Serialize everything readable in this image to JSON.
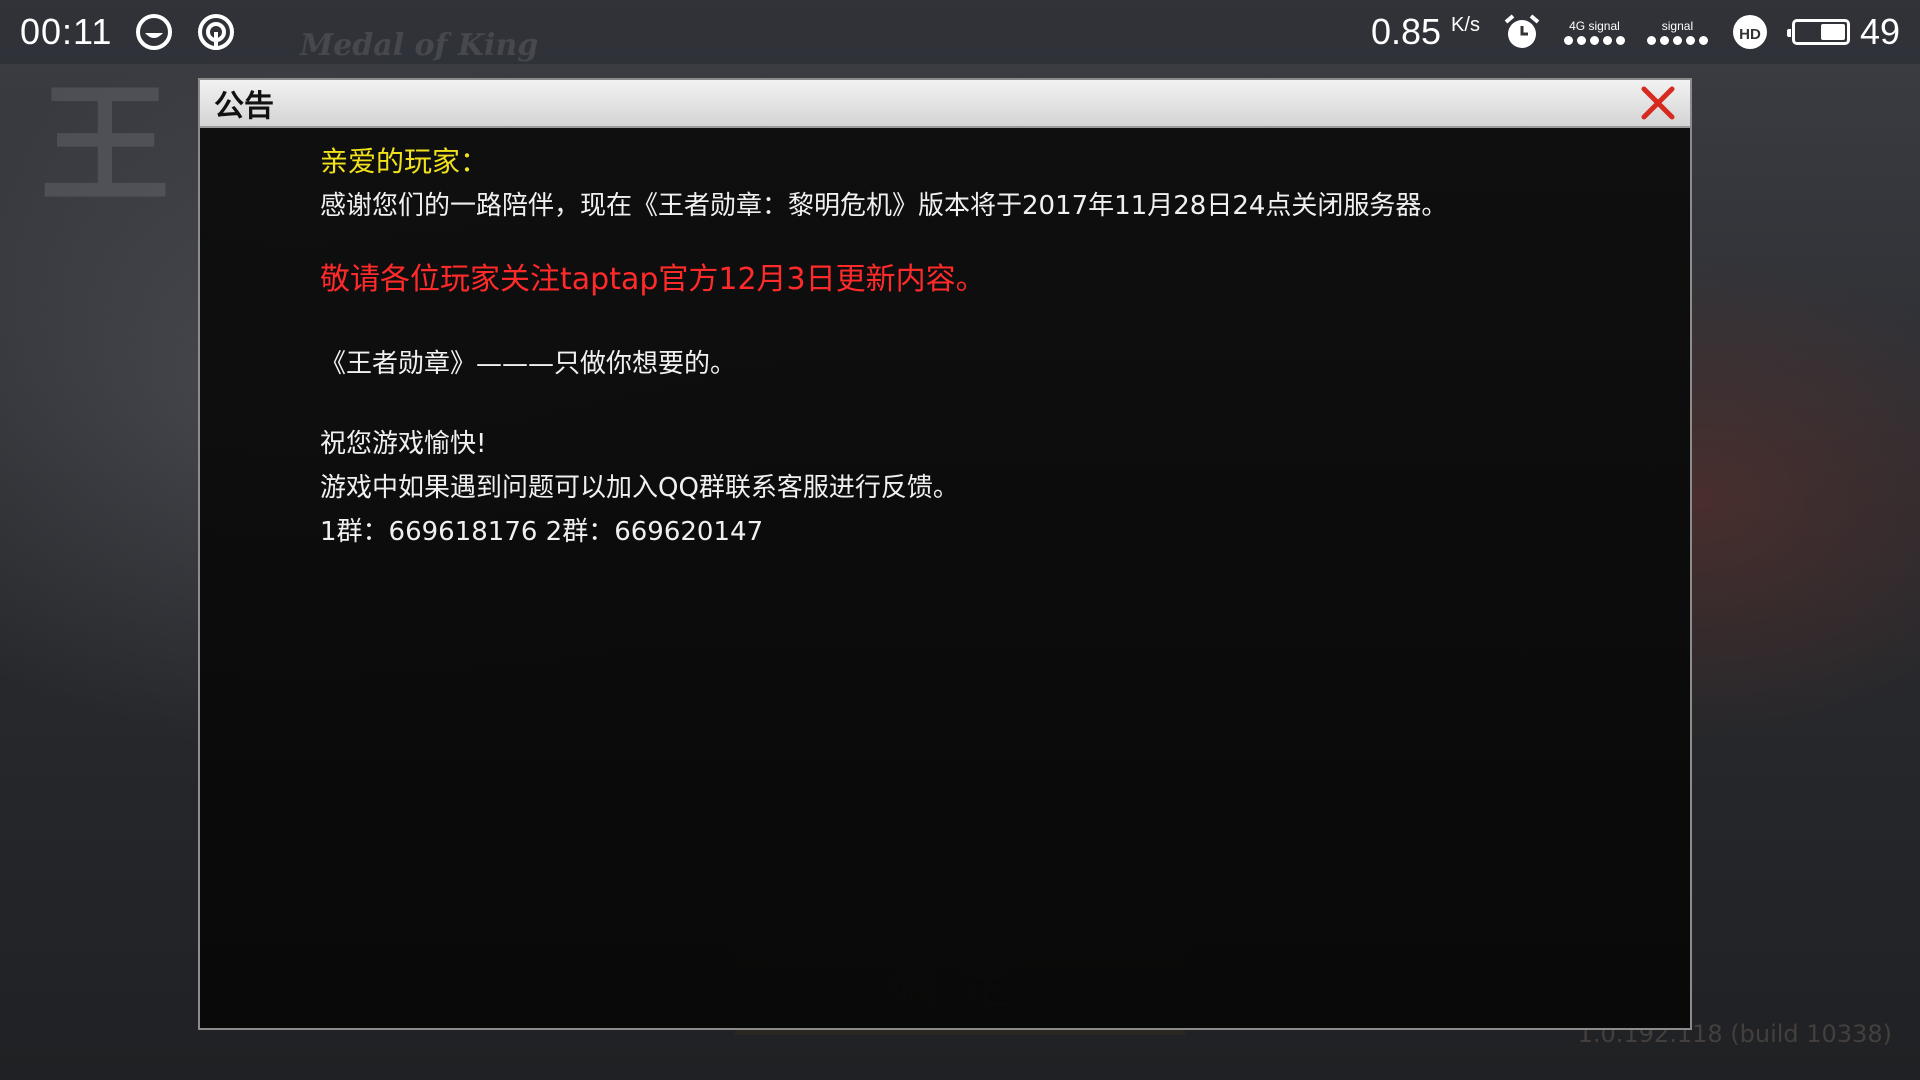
{
  "status_bar": {
    "time": "00:11",
    "net_speed_value": "0.85",
    "net_speed_unit": "K/s",
    "network_type": "4G",
    "signal_label_1": "signal",
    "signal_label_2": "signal",
    "hd_label": "HD",
    "battery_level": "49",
    "battery_fraction": 0.49
  },
  "background": {
    "logo_text": "Medal of King",
    "version_text": "1.0.192.118 (build 10338)"
  },
  "dialog": {
    "title": "公告",
    "greeting": "亲爱的玩家：",
    "line_thanks": "感谢您们的一路陪伴，现在《王者勋章：黎明危机》版本将于2017年11月28日24点关闭服务器。",
    "line_notice": "敬请各位玩家关注taptap官方12月3日更新内容。",
    "line_slogan": "《王者勋章》———只做你想要的。",
    "line_wish": "祝您游戏愉快!",
    "line_feedback": "游戏中如果遇到问题可以加入QQ群联系客服进行反馈。",
    "line_groups": "1群：669618176    2群：669620147",
    "colors": {
      "greeting": "#f2e21c",
      "notice": "#ff2a2a",
      "close": "#d62a1e"
    }
  },
  "icons": {
    "close": "close-icon",
    "alarm": "alarm-icon",
    "hd": "hd-icon",
    "hotspot": "hotspot-icon",
    "smile_app": "app-icon"
  }
}
